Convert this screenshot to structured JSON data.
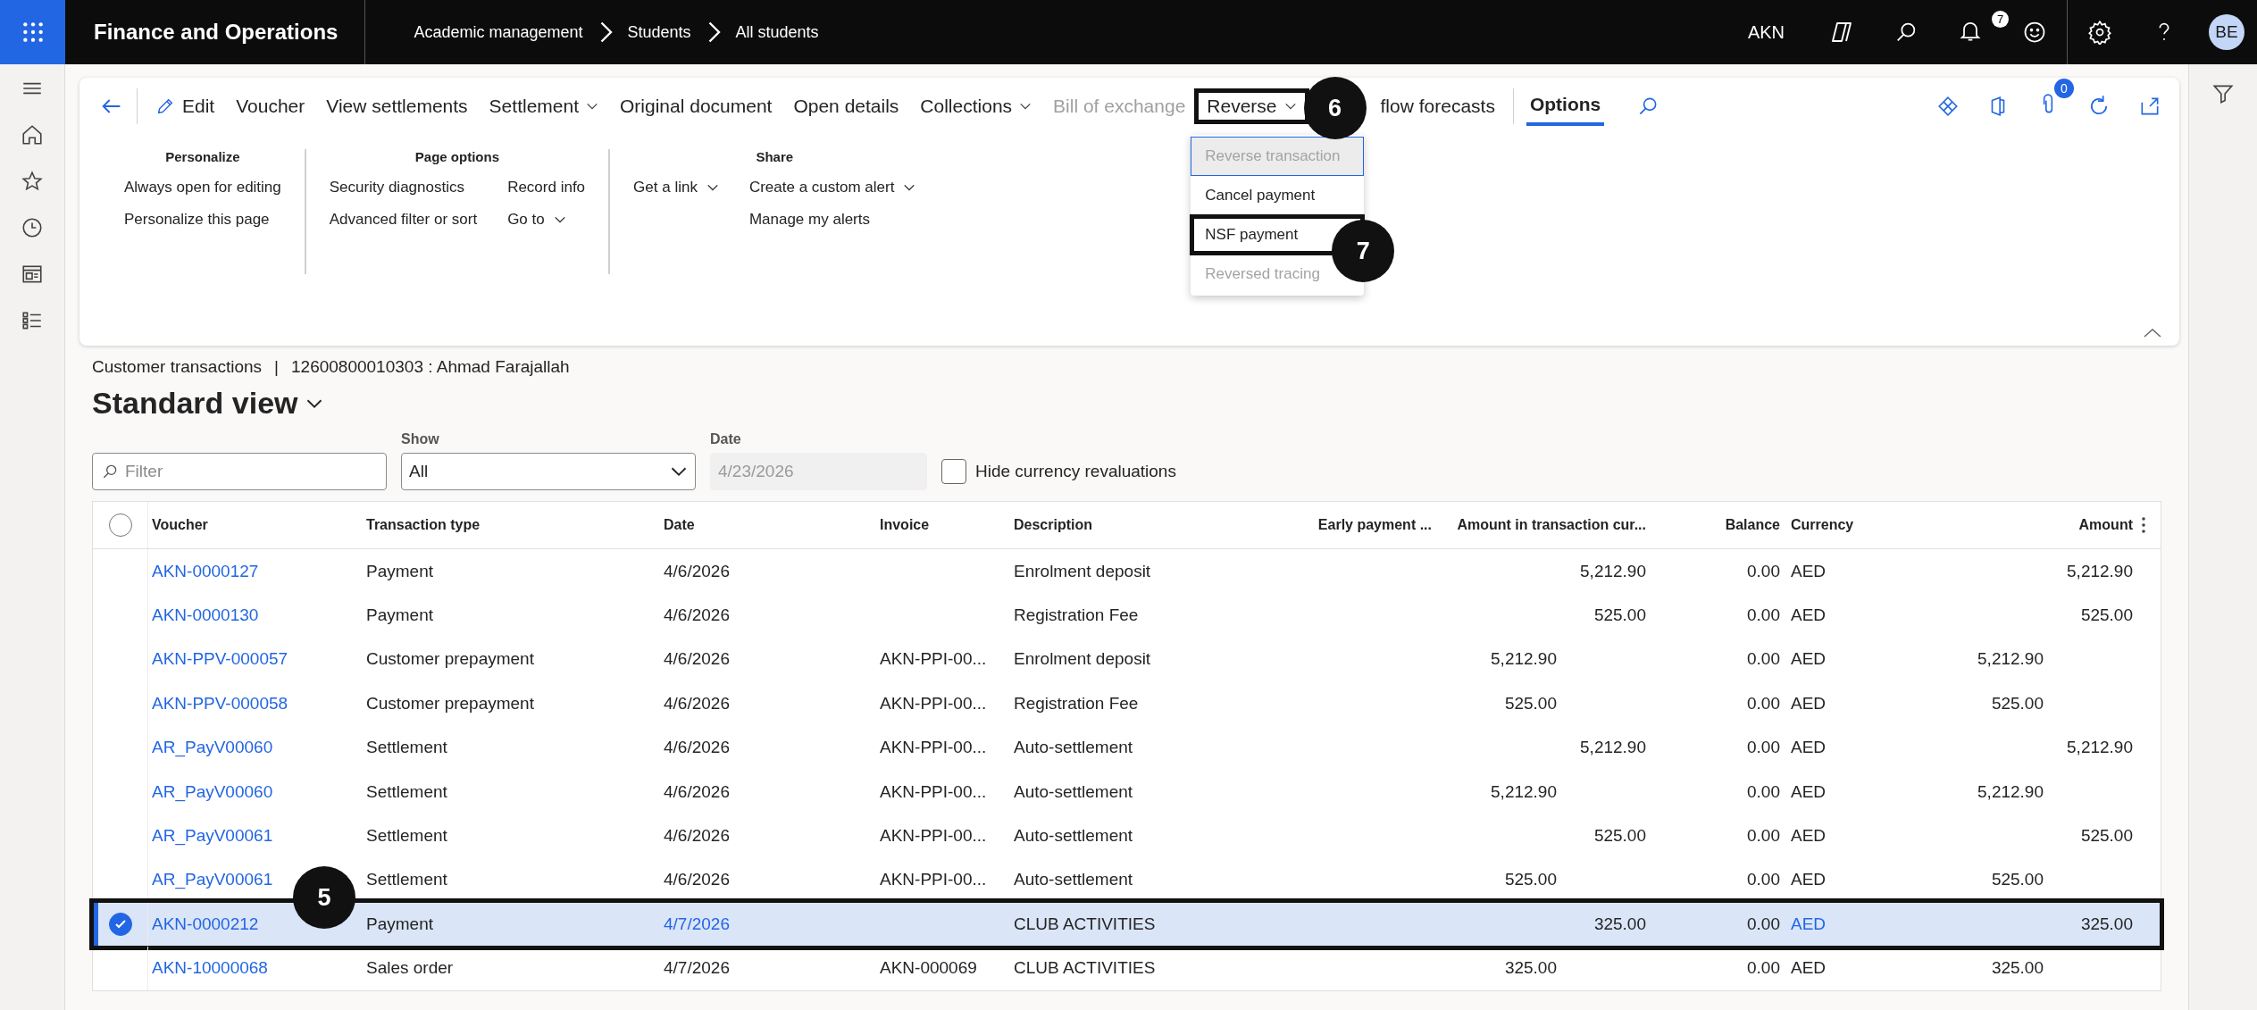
{
  "top_bar": {
    "app_title": "Finance and Operations",
    "breadcrumb": [
      "Academic management",
      "Students",
      "All students"
    ],
    "company": "AKN",
    "notifications_badge": "7",
    "avatar_initials": "BE"
  },
  "action_pane": {
    "items": [
      {
        "label": "Edit",
        "kind": "edit",
        "disabled": false
      },
      {
        "label": "Voucher",
        "kind": "button",
        "disabled": false
      },
      {
        "label": "View settlements",
        "kind": "button",
        "disabled": false
      },
      {
        "label": "Settlement",
        "kind": "menu",
        "disabled": false
      },
      {
        "label": "Original document",
        "kind": "button",
        "disabled": false
      },
      {
        "label": "Open details",
        "kind": "button",
        "disabled": false
      },
      {
        "label": "Collections",
        "kind": "menu",
        "disabled": false
      },
      {
        "label": "Bill of exchange",
        "kind": "button",
        "disabled": true
      },
      {
        "label": "Reverse",
        "kind": "menu",
        "disabled": false,
        "callout": "6"
      },
      {
        "label": "flow forecasts",
        "kind": "button",
        "disabled": false
      }
    ],
    "tab": {
      "label": "Options",
      "selected": true
    },
    "attachments_badge": "0",
    "menu": [
      {
        "label": "Reverse transaction",
        "disabled": true,
        "selected": true
      },
      {
        "label": "Cancel payment",
        "disabled": false,
        "selected": false
      },
      {
        "label": "NSF payment",
        "disabled": false,
        "selected": false,
        "callout": "7"
      },
      {
        "label": "Reversed tracing",
        "disabled": true,
        "selected": false
      }
    ],
    "groups": [
      {
        "title": "Personalize",
        "columns": [
          [
            {
              "label": "Always open for editing",
              "dropdown": false
            },
            {
              "label": "Personalize this page",
              "dropdown": false
            }
          ]
        ]
      },
      {
        "title": "Page options",
        "columns": [
          [
            {
              "label": "Security diagnostics",
              "dropdown": false
            },
            {
              "label": "Advanced filter or sort",
              "dropdown": false
            }
          ],
          [
            {
              "label": "Record info",
              "dropdown": false
            },
            {
              "label": "Go to",
              "dropdown": true
            }
          ]
        ]
      },
      {
        "title": "Share",
        "columns": [
          [
            {
              "label": "Get a link",
              "dropdown": true
            }
          ],
          [
            {
              "label": "Create a custom alert",
              "dropdown": true
            },
            {
              "label": "Manage my alerts",
              "dropdown": false
            }
          ]
        ]
      }
    ]
  },
  "page": {
    "caption": "Customer transactions",
    "separator": "|",
    "record": "12600800010303 : Ahmad Farajallah",
    "view": "Standard view"
  },
  "filters": {
    "filter": {
      "placeholder": "Filter"
    },
    "show": {
      "label": "Show",
      "value": "All"
    },
    "date": {
      "label": "Date",
      "value": "4/23/2026",
      "disabled": true
    },
    "hide_revaluations": {
      "label": "Hide currency revaluations",
      "checked": false
    }
  },
  "grid": {
    "all_selected": false,
    "columns": [
      "Voucher",
      "Transaction type",
      "Date",
      "Invoice",
      "Description",
      "Early payment ...",
      "Amount in transaction cur...",
      "Balance",
      "Currency",
      "Amount"
    ],
    "rows": [
      {
        "voucher": "AKN-0000127",
        "transaction_type": "Payment",
        "date": "4/6/2026",
        "description": "Enrolment deposit",
        "amount_in_transaction_currency": "5,212.90",
        "balance": "0.00",
        "currency": "AED",
        "amount": "5,212.90",
        "kind": "debit",
        "selected": false
      },
      {
        "voucher": "AKN-0000130",
        "transaction_type": "Payment",
        "date": "4/6/2026",
        "description": "Registration Fee",
        "amount_in_transaction_currency": "525.00",
        "balance": "0.00",
        "currency": "AED",
        "amount": "525.00",
        "kind": "debit",
        "selected": false
      },
      {
        "voucher": "AKN-PPV-000057",
        "transaction_type": "Customer prepayment",
        "date": "4/6/2026",
        "invoice": "AKN-PPI-00...",
        "description": "Enrolment deposit",
        "amount_in_transaction_currency": "5,212.90",
        "balance": "0.00",
        "currency": "AED",
        "amount": "5,212.90",
        "kind": "credit",
        "selected": false
      },
      {
        "voucher": "AKN-PPV-000058",
        "transaction_type": "Customer prepayment",
        "date": "4/6/2026",
        "invoice": "AKN-PPI-00...",
        "description": "Registration Fee",
        "amount_in_transaction_currency": "525.00",
        "balance": "0.00",
        "currency": "AED",
        "amount": "525.00",
        "kind": "credit",
        "selected": false
      },
      {
        "voucher": "AR_PayV00060",
        "transaction_type": "Settlement",
        "date": "4/6/2026",
        "invoice": "AKN-PPI-00...",
        "description": "Auto-settlement",
        "amount_in_transaction_currency": "5,212.90",
        "balance": "0.00",
        "currency": "AED",
        "amount": "5,212.90",
        "kind": "debit",
        "selected": false
      },
      {
        "voucher": "AR_PayV00060",
        "transaction_type": "Settlement",
        "date": "4/6/2026",
        "invoice": "AKN-PPI-00...",
        "description": "Auto-settlement",
        "amount_in_transaction_currency": "5,212.90",
        "balance": "0.00",
        "currency": "AED",
        "amount": "5,212.90",
        "kind": "credit",
        "selected": false
      },
      {
        "voucher": "AR_PayV00061",
        "transaction_type": "Settlement",
        "date": "4/6/2026",
        "invoice": "AKN-PPI-00...",
        "description": "Auto-settlement",
        "amount_in_transaction_currency": "525.00",
        "balance": "0.00",
        "currency": "AED",
        "amount": "525.00",
        "kind": "debit",
        "selected": false
      },
      {
        "voucher": "AR_PayV00061",
        "transaction_type": "Settlement",
        "date": "4/6/2026",
        "invoice": "AKN-PPI-00...",
        "description": "Auto-settlement",
        "amount_in_transaction_currency": "525.00",
        "balance": "0.00",
        "currency": "AED",
        "amount": "525.00",
        "kind": "credit",
        "selected": false
      },
      {
        "voucher": "AKN-0000212",
        "transaction_type": "Payment",
        "date": "4/7/2026",
        "description": "CLUB ACTIVITIES",
        "amount_in_transaction_currency": "325.00",
        "balance": "0.00",
        "currency": "AED",
        "amount": "325.00",
        "kind": "debit",
        "selected": true,
        "callout": "5"
      },
      {
        "voucher": "AKN-10000068",
        "transaction_type": "Sales order",
        "date": "4/7/2026",
        "invoice": "AKN-000069",
        "description": "CLUB ACTIVITIES",
        "amount_in_transaction_currency": "325.00",
        "balance": "0.00",
        "currency": "AED",
        "amount": "325.00",
        "kind": "credit",
        "selected": false
      }
    ]
  }
}
